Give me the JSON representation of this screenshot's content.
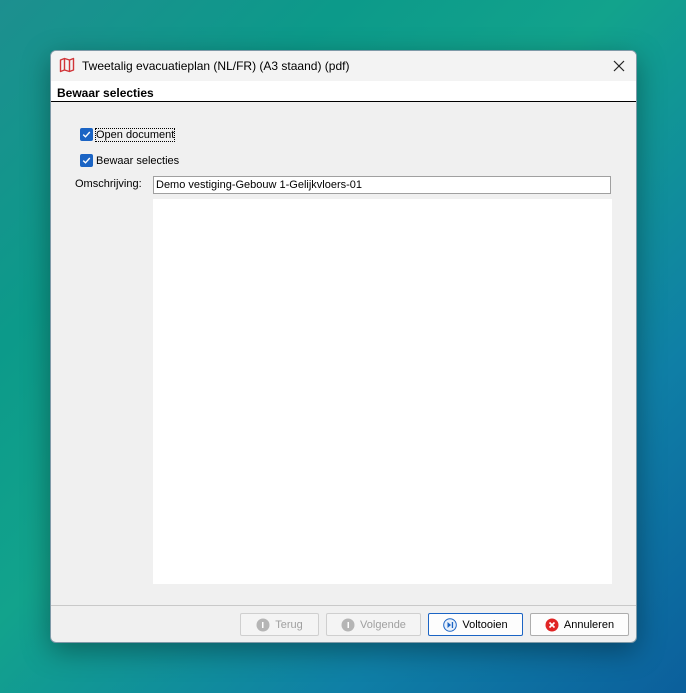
{
  "window": {
    "title": "Tweetalig evacuatieplan (NL/FR) (A3 staand) (pdf)"
  },
  "header": {
    "title": "Bewaar selecties"
  },
  "options": {
    "open_document": {
      "label": "Open document",
      "checked": true
    },
    "save_selections": {
      "label": "Bewaar selecties",
      "checked": true
    }
  },
  "description": {
    "label": "Omschrijving:",
    "value": "Demo vestiging-Gebouw 1-Gelijkvloers-01",
    "memo": ""
  },
  "buttons": {
    "back": "Terug",
    "next": "Volgende",
    "finish": "Voltooien",
    "cancel": "Annuleren"
  },
  "colors": {
    "accent": "#1b64c4",
    "cancel_icon": "#e02424",
    "title_icon": "#d13438"
  }
}
